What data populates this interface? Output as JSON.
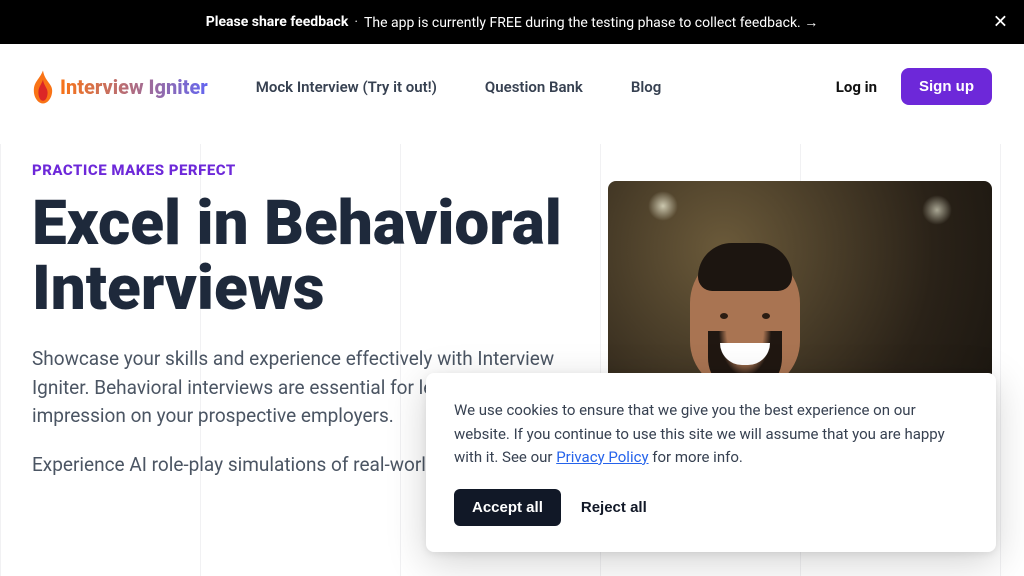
{
  "banner": {
    "bold": "Please share feedback",
    "text": "The app is currently FREE during the testing phase to collect feedback. →"
  },
  "logo": {
    "text": "Interview Igniter"
  },
  "nav": {
    "links": [
      "Mock Interview (Try it out!)",
      "Question Bank",
      "Blog"
    ],
    "login": "Log in",
    "signup": "Sign up"
  },
  "hero": {
    "eyebrow": "PRACTICE MAKES PERFECT",
    "title": "Excel in Behavioral Interviews",
    "body1": "Showcase your skills and experience effectively with Interview Igniter. Behavioral interviews are essential for leaving a positive impression on your prospective employers.",
    "body2": "Experience AI role-play simulations of real-world"
  },
  "cookie": {
    "text_prefix": "We use cookies to ensure that we give you the best experience on our website. If you continue to use this site we will assume that you are happy with it. See our ",
    "link": "Privacy Policy",
    "text_suffix": " for more info.",
    "accept": "Accept all",
    "reject": "Reject all"
  }
}
